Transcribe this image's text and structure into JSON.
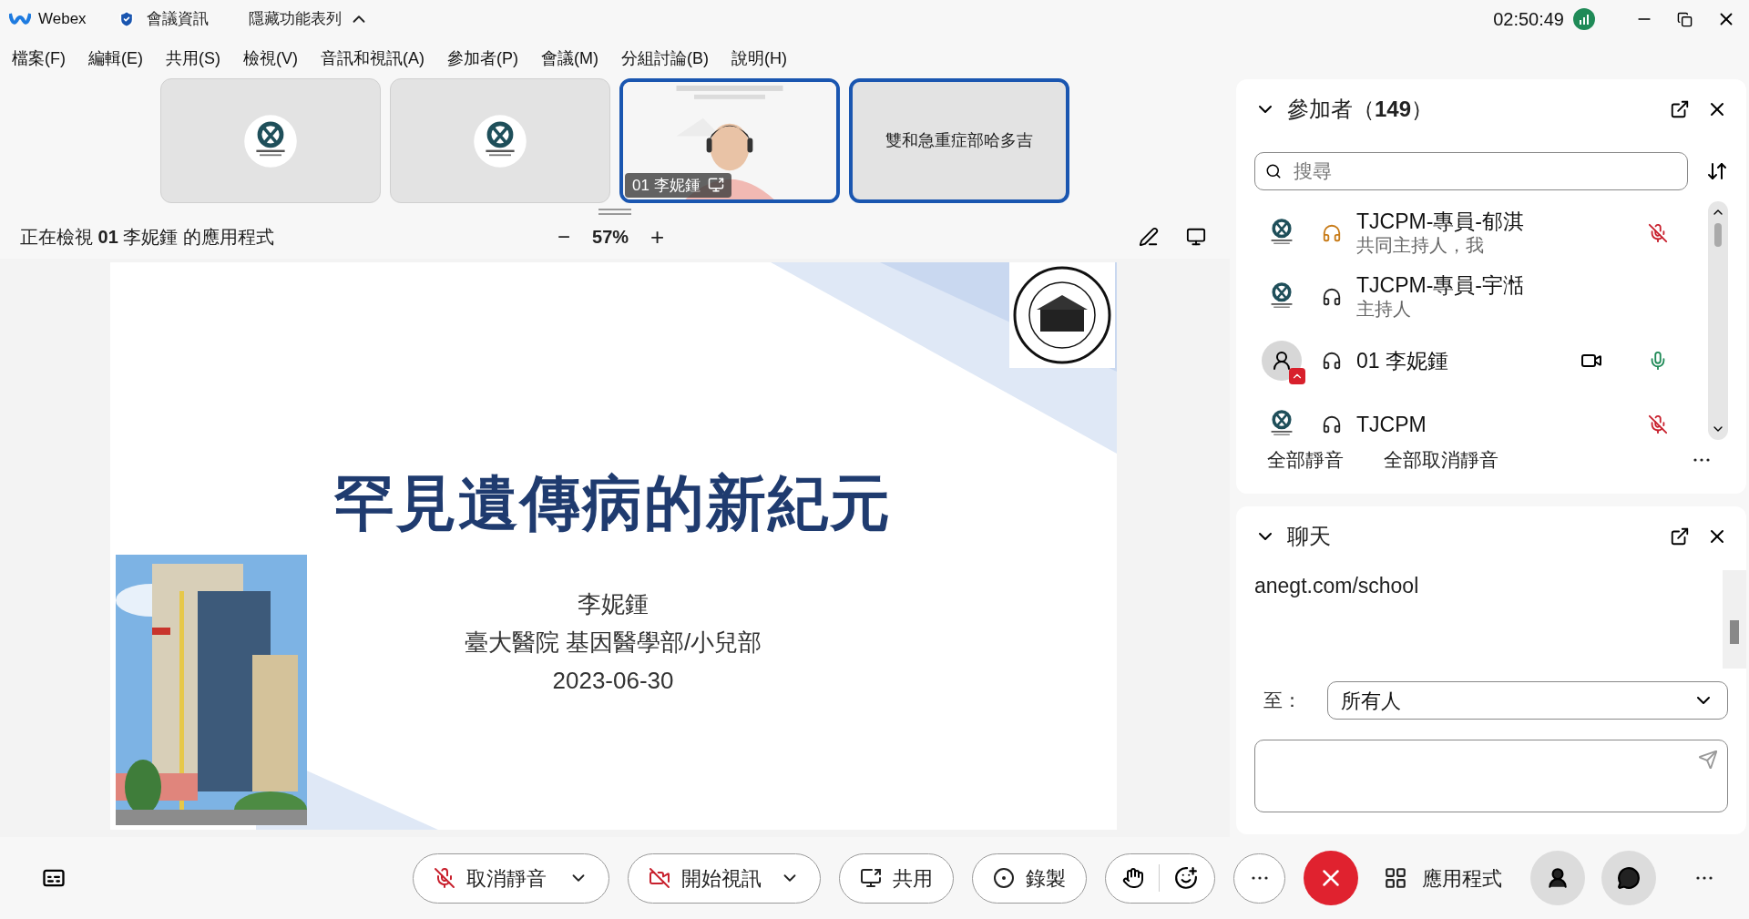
{
  "title_bar": {
    "app_name": "Webex",
    "meeting_info": "會議資訊",
    "hide_menu": "隱藏功能表列",
    "clock": "02:50:49"
  },
  "menu": [
    "檔案(F)",
    "編輯(E)",
    "共用(S)",
    "檢視(V)",
    "音訊和視訊(A)",
    "參加者(P)",
    "會議(M)",
    "分組討論(B)",
    "說明(H)"
  ],
  "thumbnails": [
    {
      "kind": "logo",
      "selected": false
    },
    {
      "kind": "logo",
      "selected": false
    },
    {
      "kind": "video",
      "name": "01 李妮鍾",
      "selected": true
    },
    {
      "kind": "name",
      "name": "雙和急重症部哈多吉",
      "selected": true
    }
  ],
  "viewing_bar": {
    "text": "正在檢視 **01** 李妮鍾 的應用程式",
    "zoom_minus": "−",
    "zoom": "57%",
    "zoom_plus": "+"
  },
  "slide": {
    "title": "罕見遺傳病的新紀元",
    "lines": [
      "李妮鍾",
      "臺大醫院 基因醫學部/小兒部",
      "2023-06-30"
    ]
  },
  "participants": {
    "title": "參加者",
    "count": "（**149**）",
    "search_placeholder": "搜尋",
    "items": [
      {
        "logo_avatar": true,
        "audio_warning": true,
        "name": "TJCPM-專員-郁淇",
        "role": "共同主持人，我",
        "video": false,
        "mic_shown": true,
        "muted": true
      },
      {
        "logo_avatar": true,
        "audio_warning": false,
        "name": "TJCPM-專員-宇湉",
        "role": "主持人",
        "video": false,
        "mic_shown": false
      },
      {
        "logo_avatar": false,
        "audio_warning": false,
        "name": "01 李妮鍾",
        "video": true,
        "mic_shown": true,
        "muted": false
      },
      {
        "logo_avatar": true,
        "audio_warning": false,
        "name": "TJCPM",
        "video": false,
        "mic_shown": true,
        "muted": true
      }
    ],
    "mute_all": "全部靜音",
    "unmute_all": "全部取消靜音"
  },
  "chat": {
    "title": "聊天",
    "messages": [
      "anegt.com/school"
    ],
    "to_label": "至：",
    "recipient": "所有人"
  },
  "toolbar": [
    {
      "kind": "mic",
      "label": "取消靜音",
      "muted": true
    },
    {
      "kind": "video",
      "label": "開始視訊",
      "off": true
    },
    {
      "kind": "share",
      "label": "共用"
    },
    {
      "kind": "record",
      "label": "錄製"
    },
    {
      "kind": "reactions"
    },
    {
      "kind": "more"
    },
    {
      "kind": "end"
    },
    {
      "kind": "apps",
      "label": "應用程式"
    }
  ]
}
